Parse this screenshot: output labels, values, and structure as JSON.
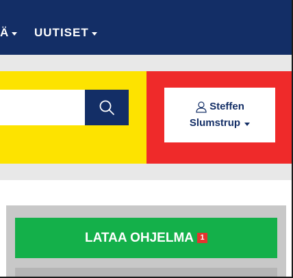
{
  "nav": {
    "items": [
      {
        "label": "Ä"
      },
      {
        "label": "UUTISET"
      }
    ]
  },
  "search": {
    "placeholder": "",
    "value": "",
    "icon": "search-icon"
  },
  "user": {
    "first_name": "Steffen",
    "last_name": "Slumstrup",
    "icon": "user-icon"
  },
  "download": {
    "label": "LATAA OHJELMA",
    "badge": "1"
  },
  "colors": {
    "nav_bg": "#132e66",
    "search_band": "#fde300",
    "user_band": "#ef2a2a",
    "download_btn": "#14b04a",
    "badge": "#e3342f"
  }
}
